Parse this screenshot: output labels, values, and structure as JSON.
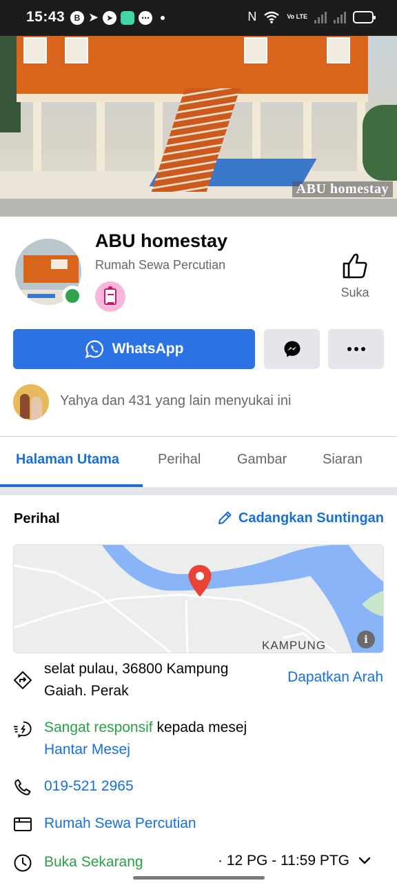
{
  "status_bar": {
    "time": "15:43",
    "notification_icons": [
      "b-icon",
      "telegram-icon",
      "telegram-icon",
      "chat-app-icon",
      "message-bubble-icon"
    ],
    "network": "Vo LTE"
  },
  "cover": {
    "watermark": "ABU homestay"
  },
  "profile": {
    "name": "ABU homestay",
    "category": "Rumah Sewa Percutian",
    "like_label": "Suka"
  },
  "actions": {
    "whatsapp_label": "WhatsApp"
  },
  "social": {
    "likes_text": "Yahya dan 431 yang lain menyukai ini"
  },
  "tabs": [
    {
      "label": "Halaman Utama",
      "active": true
    },
    {
      "label": "Perihal",
      "active": false
    },
    {
      "label": "Gambar",
      "active": false
    },
    {
      "label": "Siaran",
      "active": false
    }
  ],
  "about": {
    "title": "Perihal",
    "suggest_edit_label": "Cadangkan Suntingan",
    "map_label": "KAMPUNG",
    "address_line1": "selat pulau, 36800 Kampung",
    "address_line2": "Gaiah. Perak",
    "directions_label": "Dapatkan Arah",
    "responsive_strong": "Sangat responsif",
    "responsive_rest": " kepada mesej",
    "send_message_label": "Hantar Mesej",
    "phone": "019-521 2965",
    "category_link": "Rumah Sewa Percutian",
    "open_status": "Buka Sekarang",
    "hours": "· 12 PG - 11:59 PTG"
  },
  "colors": {
    "facebook_blue": "#1a6ed8",
    "whatsapp_button": "#2d72e3",
    "online_green": "#31a24c",
    "secondary_text": "#65676b"
  }
}
